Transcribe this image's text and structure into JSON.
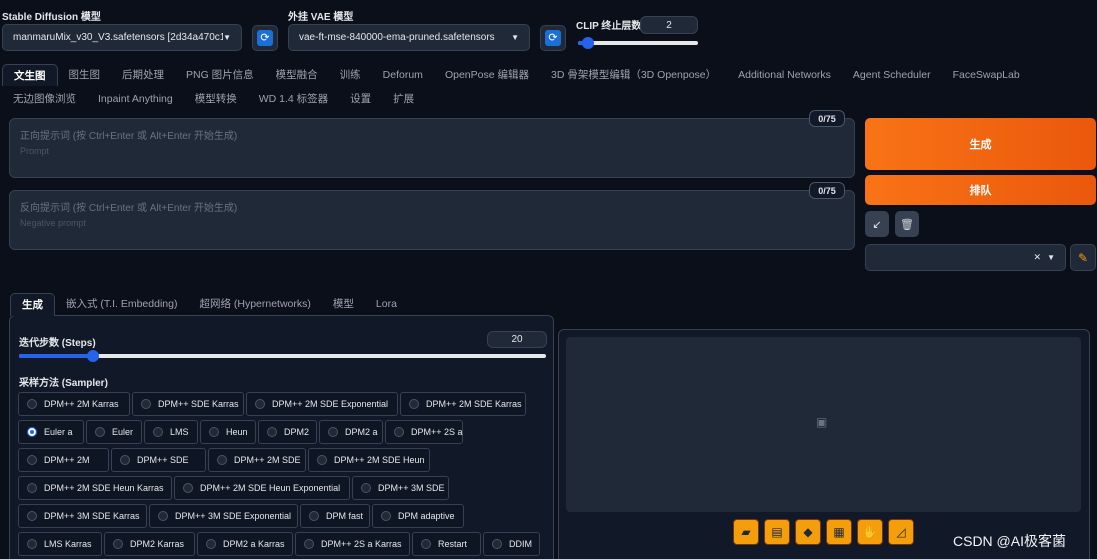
{
  "models": {
    "sd_label": "Stable Diffusion 模型",
    "sd_value": "manmaruMix_v30_V3.safetensors [2d34a470c1]",
    "vae_label": "外挂 VAE 模型",
    "vae_value": "vae-ft-mse-840000-ema-pruned.safetensors",
    "clip_label": "CLIP 终止层数",
    "clip_value": "2",
    "clip_fraction": 0.08
  },
  "main_tabs": [
    [
      "文生图",
      "图生图",
      "后期处理",
      "PNG 图片信息",
      "模型融合",
      "训练",
      "Deforum",
      "OpenPose 编辑器",
      "3D 骨架模型编辑（3D Openpose）",
      "Additional Networks",
      "Agent Scheduler",
      "FaceSwapLab"
    ],
    [
      "无边图像浏览",
      "Inpaint Anything",
      "模型转换",
      "WD 1.4 标签器",
      "设置",
      "扩展"
    ]
  ],
  "prompt": {
    "placeholder": "正向提示词 (按 Ctrl+Enter 或 Alt+Enter 开始生成)",
    "sub": "Prompt",
    "count": "0/75"
  },
  "negative": {
    "placeholder": "反向提示词 (按 Ctrl+Enter 或 Alt+Enter 开始生成)",
    "sub": "Negative prompt",
    "count": "0/75"
  },
  "actions": {
    "generate": "生成",
    "queue": "排队"
  },
  "sub_tabs": [
    "生成",
    "嵌入式 (T.I. Embedding)",
    "超网络 (Hypernetworks)",
    "模型",
    "Lora"
  ],
  "steps": {
    "label": "迭代步数 (Steps)",
    "value": "20",
    "fraction": 0.14
  },
  "sampler": {
    "label": "采样方法 (Sampler)",
    "selected": "Euler a",
    "rows": [
      [
        "DPM++ 2M Karras",
        "DPM++ SDE Karras",
        "DPM++ 2M SDE Exponential",
        "DPM++ 2M SDE Karras"
      ],
      [
        "Euler a",
        "Euler",
        "LMS",
        "Heun",
        "DPM2",
        "DPM2 a",
        "DPM++ 2S a"
      ],
      [
        "DPM++ 2M",
        "DPM++ SDE",
        "DPM++ 2M SDE",
        "DPM++ 2M SDE Heun"
      ],
      [
        "DPM++ 2M SDE Heun Karras",
        "DPM++ 2M SDE Heun Exponential",
        "DPM++ 3M SDE"
      ],
      [
        "DPM++ 3M SDE Karras",
        "DPM++ 3M SDE Exponential",
        "DPM fast",
        "DPM adaptive"
      ],
      [
        "LMS Karras",
        "DPM2 Karras",
        "DPM2 a Karras",
        "DPM++ 2S a Karras",
        "Restart",
        "DDIM"
      ]
    ]
  },
  "watermark": "CSDN @AI极客菌"
}
